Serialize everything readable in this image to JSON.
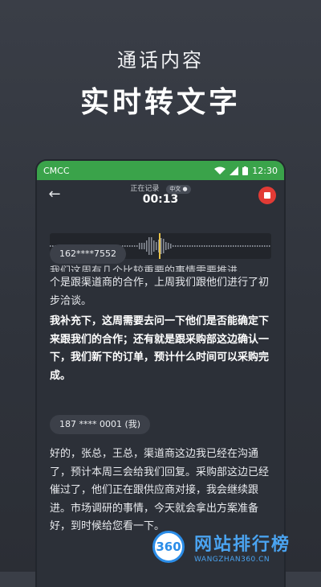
{
  "promo": {
    "subtitle": "通话内容",
    "title": "实时转文字"
  },
  "status_bar": {
    "carrier": "CMCC",
    "time": "12:30"
  },
  "header": {
    "rec_status": "正在记录",
    "lang_badge": "中文",
    "timer": "00:13"
  },
  "speakers": [
    {
      "label": "162****7552"
    },
    {
      "label": "187 **** 0001 (我)"
    }
  ],
  "transcript": {
    "partial": "我们这周有几个比较重要的事情需要推进。",
    "para1": "个是跟渠道商的合作，上周我们跟他们进行了初步洽谈。",
    "para2_bold": "我补充下，这周需要去问一下他们是否能确定下来跟我们的合作；还有就是跟采购部这边确认一下，我们新下的订单，预计什么时间可以采购完成。",
    "para3": "好的，张总，王总，渠道商这边我已经在沟通了，预计本周三会给我们回复。采购部这边已经催过了，他们正在跟供应商对接，我会继续跟进。市场调研的事情，今天就会拿出方案准备好，到时候给您看一下。"
  },
  "watermark": {
    "logo_text": "360",
    "name": "网站排行榜",
    "url": "WANGZHAN360.CN"
  },
  "colors": {
    "status_bar": "#3aa34a",
    "record_button": "#e23b35",
    "wave_accent": "#e7c24a"
  }
}
